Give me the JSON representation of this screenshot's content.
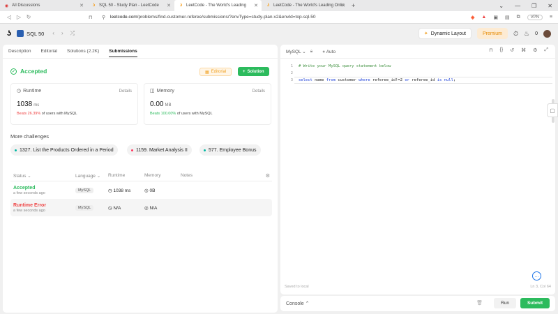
{
  "browser": {
    "tabs": [
      {
        "title": "All Discussions",
        "active": false,
        "icon": "reddit-icon"
      },
      {
        "title": "SQL 50 - Study Plan - LeetCode",
        "active": false,
        "icon": "leetcode-icon"
      },
      {
        "title": "LeetCode - The World's Leading",
        "active": true,
        "icon": "leetcode-icon"
      },
      {
        "title": "LeetCode - The World's Leading Onlin",
        "active": false,
        "icon": "leetcode-icon"
      }
    ],
    "url_host": "leetcode.com",
    "url_path": "/problems/find-customer-referee/submissions/?envType=study-plan-v2&envId=top-sql-50",
    "vpn_label": "VPN"
  },
  "lc_header": {
    "study_plan": "SQL 50",
    "dynamic_layout": "Dynamic Layout",
    "premium": "Premium",
    "points": "0"
  },
  "left_tabs": [
    "Description",
    "Editorial",
    "Solutions (2.2K)",
    "Submissions"
  ],
  "result": {
    "status": "Accepted",
    "editorial_btn": "Editorial",
    "solution_btn": "Solution",
    "runtime": {
      "label": "Runtime",
      "details": "Details",
      "value": "1038",
      "unit": "ms",
      "beats_pct": "Beats 26.39%",
      "beats_rest": "of users with MySQL"
    },
    "memory": {
      "label": "Memory",
      "details": "Details",
      "value": "0.00",
      "unit": "MB",
      "beats_pct": "Beats 100.00%",
      "beats_rest": "of users with MySQL"
    }
  },
  "more_challenges": {
    "title": "More challenges",
    "items": [
      {
        "label": "1327. List the Products Ordered in a Period",
        "color": "#00b8a3"
      },
      {
        "label": "1159. Market Analysis II",
        "color": "#ff375f"
      },
      {
        "label": "577. Employee Bonus",
        "color": "#00b8a3"
      }
    ]
  },
  "submissions_table": {
    "headers": [
      "Status",
      "Language",
      "Runtime",
      "Memory",
      "Notes"
    ],
    "rows": [
      {
        "status": "Accepted",
        "when": "a few seconds ago",
        "language": "MySQL",
        "runtime": "1038 ms",
        "memory": "0B"
      },
      {
        "status": "Runtime Error",
        "when": "a few seconds ago",
        "language": "MySQL",
        "runtime": "N/A",
        "memory": "N/A"
      }
    ]
  },
  "editor": {
    "language": "MySQL",
    "mode": "Auto",
    "lines": [
      {
        "n": "1",
        "comment": "# Write your MySQL query statement below"
      },
      {
        "n": "2"
      },
      {
        "n": "3",
        "kw1": "select",
        "t1": " name ",
        "kw2": "from",
        "t2": " customer ",
        "kw3": "where",
        "t3": " referee_id!=2 ",
        "kw4": "or",
        "t4": " referee_id ",
        "kw5": "is",
        "t5": " ",
        "kw6": "null",
        "t6": ";"
      }
    ],
    "saved": "Saved to local",
    "position": "Ln 3, Col 64"
  },
  "console": {
    "label": "Console",
    "run": "Run",
    "submit": "Submit"
  }
}
